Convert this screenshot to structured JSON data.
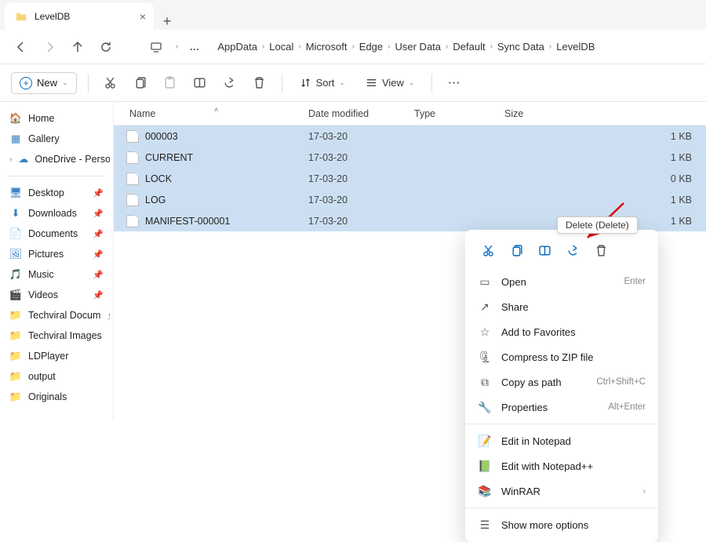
{
  "tab": {
    "title": "LevelDB"
  },
  "breadcrumb": [
    "AppData",
    "Local",
    "Microsoft",
    "Edge",
    "User Data",
    "Default",
    "Sync Data",
    "LevelDB"
  ],
  "toolbar": {
    "new": "New",
    "sort": "Sort",
    "view": "View"
  },
  "sidebar": {
    "top": [
      {
        "icon": "home",
        "label": "Home"
      },
      {
        "icon": "gallery",
        "label": "Gallery"
      },
      {
        "icon": "onedrive",
        "label": "OneDrive - Persona",
        "expand": true
      }
    ],
    "pinned": [
      {
        "icon": "desktop",
        "label": "Desktop",
        "pin": true,
        "color": "#3b82c4"
      },
      {
        "icon": "down",
        "label": "Downloads",
        "pin": true,
        "color": "#3b82c4"
      },
      {
        "icon": "doc",
        "label": "Documents",
        "pin": true,
        "color": "#3b82c4"
      },
      {
        "icon": "pic",
        "label": "Pictures",
        "pin": true,
        "color": "#3b82c4"
      },
      {
        "icon": "music",
        "label": "Music",
        "pin": true,
        "color": "#d63384"
      },
      {
        "icon": "video",
        "label": "Videos",
        "pin": true,
        "color": "#6f42c1"
      },
      {
        "icon": "folder",
        "label": "Techviral Docum",
        "pin": true,
        "color": "#f8d477"
      },
      {
        "icon": "folder",
        "label": "Techviral Images",
        "color": "#f8d477"
      },
      {
        "icon": "folder",
        "label": "LDPlayer",
        "color": "#f8d477"
      },
      {
        "icon": "folder",
        "label": "output",
        "color": "#f8d477"
      },
      {
        "icon": "folder",
        "label": "Originals",
        "color": "#f8d477"
      }
    ]
  },
  "columns": {
    "name": "Name",
    "date": "Date modified",
    "type": "Type",
    "size": "Size"
  },
  "files": [
    {
      "name": "000003",
      "date": "17-03-20",
      "size": "1 KB"
    },
    {
      "name": "CURRENT",
      "date": "17-03-20",
      "size": "1 KB"
    },
    {
      "name": "LOCK",
      "date": "17-03-20",
      "size": "0 KB"
    },
    {
      "name": "LOG",
      "date": "17-03-20",
      "size": "1 KB"
    },
    {
      "name": "MANIFEST-000001",
      "date": "17-03-20",
      "size": "1 KB"
    }
  ],
  "tooltip": "Delete (Delete)",
  "ctx": {
    "open": {
      "label": "Open",
      "kbd": "Enter"
    },
    "share": {
      "label": "Share"
    },
    "fav": {
      "label": "Add to Favorites"
    },
    "zip": {
      "label": "Compress to ZIP file"
    },
    "copypath": {
      "label": "Copy as path",
      "kbd": "Ctrl+Shift+C"
    },
    "props": {
      "label": "Properties",
      "kbd": "Alt+Enter"
    },
    "notepad": {
      "label": "Edit in Notepad"
    },
    "npp": {
      "label": "Edit with Notepad++"
    },
    "winrar": {
      "label": "WinRAR"
    },
    "more": {
      "label": "Show more options"
    }
  }
}
